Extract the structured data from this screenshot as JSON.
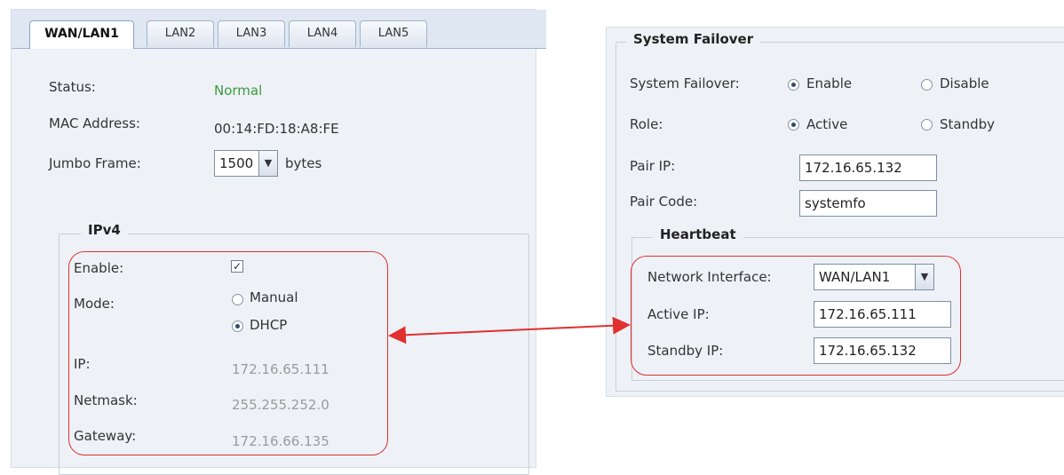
{
  "tabs": [
    "WAN/LAN1",
    "LAN2",
    "LAN3",
    "LAN4",
    "LAN5"
  ],
  "left": {
    "status_label": "Status:",
    "status_value": "Normal",
    "mac_label": "MAC Address:",
    "mac_value": "00:14:FD:18:A8:FE",
    "jumbo_label": "Jumbo Frame:",
    "jumbo_value": "1500",
    "jumbo_unit": "bytes",
    "ipv4": {
      "legend": "IPv4",
      "enable_label": "Enable:",
      "enable_checked": true,
      "mode_label": "Mode:",
      "mode_manual": "Manual",
      "mode_dhcp": "DHCP",
      "mode_selected": "DHCP",
      "ip_label": "IP:",
      "ip_value": "172.16.65.111",
      "netmask_label": "Netmask:",
      "netmask_value": "255.255.252.0",
      "gateway_label": "Gateway:",
      "gateway_value": "172.16.66.135"
    }
  },
  "right": {
    "legend": "System Failover",
    "failover_label": "System Failover:",
    "failover_enable": "Enable",
    "failover_disable": "Disable",
    "failover_selected": "Enable",
    "role_label": "Role:",
    "role_active": "Active",
    "role_standby": "Standby",
    "role_selected": "Active",
    "pair_ip_label": "Pair IP:",
    "pair_ip_value": "172.16.65.132",
    "pair_code_label": "Pair Code:",
    "pair_code_value": "systemfo",
    "heartbeat": {
      "legend": "Heartbeat",
      "network_interface_label": "Network Interface:",
      "network_interface_value": "WAN/LAN1",
      "active_ip_label": "Active IP:",
      "active_ip_value": "172.16.65.111",
      "standby_ip_label": "Standby IP:",
      "standby_ip_value": "172.16.65.132"
    }
  },
  "colors": {
    "status_ok": "#3c9a3c",
    "annotation": "#e03030"
  }
}
